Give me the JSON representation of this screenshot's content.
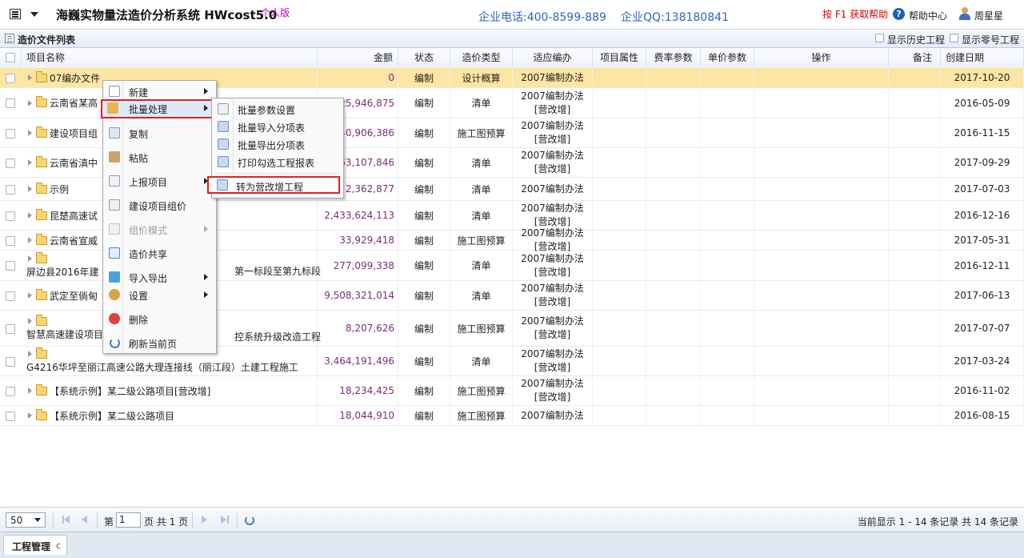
{
  "header": {
    "app_title": "海巍实物量法造价分析系统 HWcost5.0",
    "edition": "个人版",
    "phone": "企业电话:400-8599-889",
    "qq": "企业QQ:138180841",
    "f1_help": "按 F1 获取帮助",
    "help_center": "帮助中心",
    "user": "周星星"
  },
  "panel": {
    "title": "造价文件列表",
    "show_history": "显示历史工程",
    "show_zero": "显示零号工程"
  },
  "columns": {
    "name": "项目名称",
    "amount": "金额",
    "status": "状态",
    "cost_type": "造价类型",
    "method": "适应编办",
    "attr": "项目属性",
    "rate": "费率参数",
    "price": "单价参数",
    "ops": "操作",
    "note": "备注",
    "date": "创建日期"
  },
  "rows": [
    {
      "name": "07编办文件",
      "name2": "",
      "amount": "0",
      "status": "编制",
      "type": "设计概算",
      "method": "2007编制办法",
      "method2": "",
      "date": "2017-10-20"
    },
    {
      "name": "云南省某高",
      "name2": "",
      "amount": "25,946,875",
      "status": "编制",
      "type": "清单",
      "method": "2007编制办法",
      "method2": "[营改增]",
      "date": "2016-05-09"
    },
    {
      "name": "建设项目组",
      "name2": "",
      "amount": "40,906,386",
      "status": "编制",
      "type": "施工图预算",
      "method": "2007编制办法",
      "method2": "[营改增]",
      "date": "2016-11-15"
    },
    {
      "name": "云南省滇中",
      "name2": "",
      "amount": "63,107,846",
      "status": "编制",
      "type": "清单",
      "method": "2007编制办法",
      "method2": "[营改增]",
      "date": "2017-09-29"
    },
    {
      "name": "示例",
      "name2": "",
      "amount": "2,362,877",
      "status": "编制",
      "type": "清单",
      "method": "2007编制办法",
      "method2": "",
      "date": "2017-07-03"
    },
    {
      "name": "昆楚高速试",
      "name2": "",
      "amount": "2,433,624,113",
      "status": "编制",
      "type": "清单",
      "method": "2007编制办法",
      "method2": "[营改增]",
      "date": "2016-12-16"
    },
    {
      "name": "云南省宣威",
      "name2": "",
      "amount": "33,929,418",
      "status": "编制",
      "type": "施工图预算",
      "method": "2007编制办法",
      "method2": "[营改增]",
      "date": "2017-05-31"
    },
    {
      "name": "",
      "name2": "屏边县2016年建",
      "name3": "第一标段至第九标段",
      "amount": "277,099,338",
      "status": "编制",
      "type": "清单",
      "method": "2007编制办法",
      "method2": "[营改增]",
      "date": "2016-12-11"
    },
    {
      "name": "武定至倘甸",
      "name2": "",
      "amount": "9,508,321,014",
      "status": "编制",
      "type": "清单",
      "method": "2007编制办法",
      "method2": "[营改增]",
      "date": "2017-06-13"
    },
    {
      "name": "",
      "name2": "智慧高速建设项目",
      "name3": "控系统升级改造工程",
      "amount": "8,207,626",
      "status": "编制",
      "type": "施工图预算",
      "method": "2007编制办法",
      "method2": "[营改增]",
      "date": "2017-07-07"
    },
    {
      "name": "",
      "name2": "G4216华坪至丽江高速公路大理连接线（丽江段）土建工程施工",
      "name3": "",
      "amount": "3,464,191,496",
      "status": "编制",
      "type": "清单",
      "method": "2007编制办法",
      "method2": "[营改增]",
      "date": "2017-03-24"
    },
    {
      "name": "【系统示例】某二级公路项目[营改增]",
      "name2": "",
      "amount": "18,234,425",
      "status": "编制",
      "type": "施工图预算",
      "method": "2007编制办法",
      "method2": "[营改增]",
      "date": "2016-11-02"
    },
    {
      "name": "【系统示例】某二级公路项目",
      "name2": "",
      "amount": "18,044,910",
      "status": "编制",
      "type": "施工图预算",
      "method": "2007编制办法",
      "method2": "",
      "date": "2016-08-15"
    }
  ],
  "context_menu": {
    "new": "新建",
    "batch": "批量处理",
    "copy": "复制",
    "paste": "粘贴",
    "report": "上报项目",
    "build_group": "建设项目组价",
    "group_mode": "组价模式",
    "share": "造价共享",
    "import_export": "导入导出",
    "settings": "设置",
    "delete": "删除",
    "refresh": "刷新当前页"
  },
  "submenu": {
    "batch_params": "批量参数设置",
    "batch_import": "批量导入分项表",
    "batch_export": "批量导出分项表",
    "print_reports": "打印勾选工程报表",
    "convert_vat": "转为营改增工程"
  },
  "pager": {
    "page_size": "50",
    "page_prefix": "第",
    "page_value": "1",
    "page_suffix": "页 共 1 页",
    "info": "当前显示 1 - 14 条记录 共 14 条记录"
  },
  "tab": {
    "label": "工程管理",
    "close": "c"
  }
}
